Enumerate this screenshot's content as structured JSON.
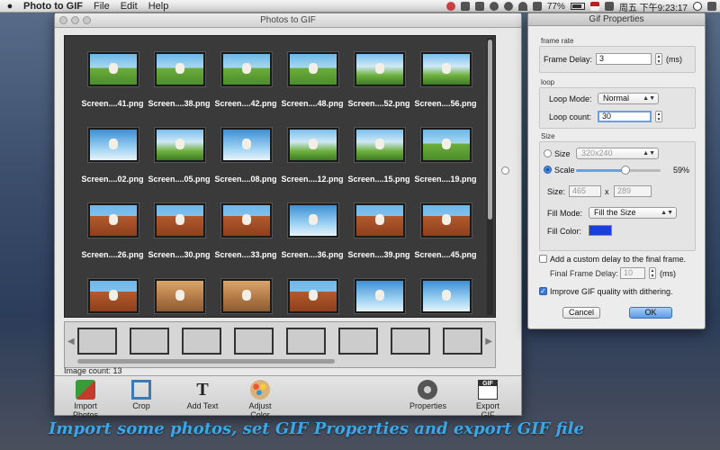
{
  "menubar": {
    "app_name": "Photo to GIF",
    "menus": [
      "File",
      "Edit",
      "Help"
    ],
    "battery": "77%",
    "clock": "周五 下午9:23:17"
  },
  "window": {
    "title": "Photos to GIF",
    "images": [
      {
        "caption": "Screen....41.png",
        "style": "t-scene"
      },
      {
        "caption": "Screen....38.png",
        "style": "t-scene"
      },
      {
        "caption": "Screen....42.png",
        "style": "t-scene"
      },
      {
        "caption": "Screen....48.png",
        "style": "t-scene"
      },
      {
        "caption": "Screen....52.png",
        "style": "t-fence"
      },
      {
        "caption": "Screen....56.png",
        "style": "t-fence"
      },
      {
        "caption": "Screen....02.png",
        "style": "t-sky"
      },
      {
        "caption": "Screen....05.png",
        "style": "t-fence"
      },
      {
        "caption": "Screen....08.png",
        "style": "t-sky"
      },
      {
        "caption": "Screen....12.png",
        "style": "t-fence"
      },
      {
        "caption": "Screen....15.png",
        "style": "t-fence"
      },
      {
        "caption": "Screen....19.png",
        "style": "t-scene"
      },
      {
        "caption": "Screen....26.png",
        "style": "t-roof"
      },
      {
        "caption": "Screen....30.png",
        "style": "t-roof"
      },
      {
        "caption": "Screen....33.png",
        "style": "t-roof"
      },
      {
        "caption": "Screen....36.png",
        "style": "t-sky"
      },
      {
        "caption": "Screen....39.png",
        "style": "t-roof"
      },
      {
        "caption": "Screen....45.png",
        "style": "t-roof"
      },
      {
        "caption": "",
        "style": "t-roof"
      },
      {
        "caption": "",
        "style": "t-room"
      },
      {
        "caption": "",
        "style": "t-room"
      },
      {
        "caption": "",
        "style": "t-roof"
      },
      {
        "caption": "",
        "style": "t-sky"
      },
      {
        "caption": "",
        "style": "t-sky"
      }
    ],
    "strip_frames": [
      "t-scene",
      "t-scene",
      "t-fence",
      "t-sky",
      "t-scene",
      "t-room",
      "t-scene",
      "t-scene"
    ],
    "image_count_label": "Image count:",
    "image_count": "13",
    "toolbar": {
      "import": "Import Photos",
      "crop": "Crop",
      "add_text": "Add Text",
      "adjust_color": "Adjust Color",
      "properties": "Properties",
      "export": "Export GIF",
      "export_icon_text": "GIF"
    }
  },
  "gif_properties": {
    "title": "Gif Properties",
    "frame_rate": {
      "section": "frame rate",
      "delay_label": "Frame Delay:",
      "delay_value": "3",
      "unit": "(ms)"
    },
    "loop": {
      "section": "loop",
      "mode_label": "Loop Mode:",
      "mode_value": "Normal",
      "count_label": "Loop count:",
      "count_value": "30"
    },
    "size": {
      "section": "Size",
      "size_option_label": "Size",
      "size_preset": "320x240",
      "scale_option_label": "Scale",
      "selected_option": "scale",
      "scale_percent": 59,
      "scale_text": "59%",
      "size_label": "Size:",
      "width": "465",
      "times": "x",
      "height": "289",
      "fill_mode_label": "Fill Mode:",
      "fill_mode_value": "Fill the Size",
      "fill_color_label": "Fill Color:",
      "fill_color": "#1a3ee0"
    },
    "final_delay": {
      "checkbox_label": "Add a custom delay to the final frame.",
      "checked": false,
      "delay_label": "Final Frame Delay:",
      "delay_value": "10",
      "unit": "(ms)"
    },
    "dithering": {
      "label": "Improve GIF quality with dithering.",
      "checked": true
    },
    "cancel": "Cancel",
    "ok": "OK"
  },
  "banner": "Import some photos, set GIF Properties and export GIF file"
}
